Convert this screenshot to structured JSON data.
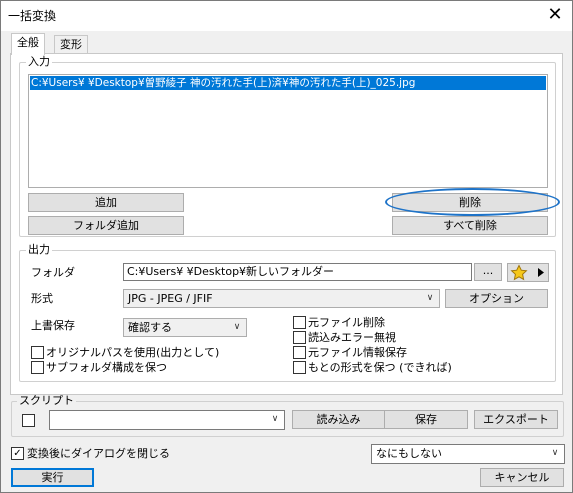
{
  "window": {
    "title": "一括変換",
    "close_glyph": "✕"
  },
  "tabs": [
    {
      "label": "全般"
    },
    {
      "label": "変形"
    }
  ],
  "input": {
    "group_label": "入力",
    "files": [
      "C:¥Users¥       ¥Desktop¥曽野綾子 神の汚れた手(上)済¥神の汚れた手(上)_025.jpg"
    ],
    "add_label": "追加",
    "add_folder_label": "フォルダ追加",
    "delete_label": "削除",
    "delete_all_label": "すべて削除"
  },
  "output": {
    "group_label": "出力",
    "folder_label": "フォルダ",
    "folder_value": "C:¥Users¥        ¥Desktop¥新しいフォルダー",
    "browse_label": "...",
    "favorite_icon": "star-icon",
    "format_label": "形式",
    "format_value": "JPG - JPEG / JFIF",
    "options_label": "オプション",
    "overwrite_label": "上書保存",
    "overwrite_value": "確認する",
    "checkboxes": {
      "delete_original": "元ファイル削除",
      "ignore_read_errors": "読込みエラー無視",
      "keep_file_info": "元ファイル情報保存",
      "keep_original_format": "もとの形式を保つ (できれば)",
      "use_original_path": "オリジナルパスを使用(出力として)",
      "keep_subfolders": "サブフォルダ構成を保つ"
    }
  },
  "script": {
    "group_label": "スクリプト",
    "load_label": "読み込み",
    "save_label": "保存",
    "export_label": "エクスポート"
  },
  "footer": {
    "close_after_label": "変換後にダイアログを閉じる",
    "close_after_checked": true,
    "check_glyph": "✓",
    "after_action_value": "なにもしない",
    "run_label": "実行",
    "cancel_label": "キャンセル"
  },
  "colors": {
    "selection": "#0078d7",
    "highlight_ring": "#1e73c8"
  }
}
